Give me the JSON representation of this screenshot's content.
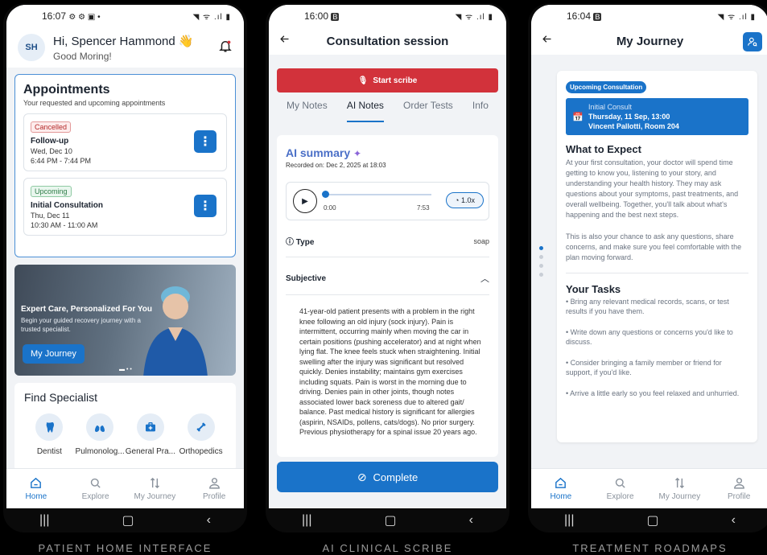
{
  "phone1": {
    "status_time": "16:07",
    "status_icons": "⚙ ⚙ ▣ •",
    "status_right": "◥ ᯤ .ıl ▮",
    "avatar_initials": "SH",
    "greeting": "Hi, Spencer Hammond 👋",
    "subgreeting": "Good Moring!",
    "appointments_title": "Appointments",
    "appointments_subtitle": "Your requested and upcoming appointments",
    "appointments": [
      {
        "status": "Cancelled",
        "title": "Follow-up",
        "date": "Wed, Dec 10",
        "time": "6:44 PM - 7:44 PM"
      },
      {
        "status": "Upcoming",
        "title": "Initial Consultation",
        "date": "Thu, Dec 11",
        "time": "10:30 AM - 11:00 AM"
      }
    ],
    "banner_title": "Expert Care, Personalized For You",
    "banner_text": "Begin your guided recovery journey with a trusted specialist.",
    "banner_button": "My Journey",
    "find_title": "Find Specialist",
    "specialists": [
      {
        "label": "Dentist",
        "icon": "tooth-icon"
      },
      {
        "label": "Pulmonolog...",
        "icon": "lungs-icon"
      },
      {
        "label": "General Pra...",
        "icon": "medical-kit-icon"
      },
      {
        "label": "Orthopedics",
        "icon": "bone-icon"
      }
    ],
    "caption": "PATIENT HOME INTERFACE"
  },
  "phone2": {
    "status_time": "16:00",
    "status_right": "◥ ᯤ .ıl ▮",
    "title": "Consultation session",
    "scribe_button": "Start scribe",
    "tabs": [
      "My Notes",
      "AI Notes",
      "Order Tests",
      "Info"
    ],
    "ai_summary_title": "AI summary",
    "recorded_on": "Recorded on: Dec 2, 2025 at 18:03",
    "time_start": "0:00",
    "time_end": "7:53",
    "speed": "1.0x",
    "type_label": "Type",
    "type_value": "soap",
    "subjective_label": "Subjective",
    "subjective_text": "41-year-old patient presents with a problem in the right knee following an old injury (sock injury). Pain is intermittent, occurring mainly when moving the car in certain positions (pushing accelerator) and at night when lying flat. The knee feels stuck when straightening. Initial swelling after the injury was significant but resolved quickly. Denies instability; maintains gym exercises including squats. Pain is worst in the morning due to driving. Denies pain in other joints, though notes associated lower back soreness due to altered gait/ balance. Past medical history is significant for allergies (aspirin, NSAIDs, pollens, cats/dogs). No prior surgery. Previous physiotherapy for a spinal issue 20 years ago.",
    "complete_button": "Complete",
    "caption": "AI CLINICAL SCRIBE"
  },
  "phone3": {
    "status_time": "16:04",
    "status_right": "◥ ᯤ .ıl ▮",
    "title": "My Journey",
    "upcoming_badge": "Upcoming Consultation",
    "consult_title": "Initial Consult",
    "consult_when": "Thursday, 11 Sep, 13:00",
    "consult_where": "Vincent Pallotti, Room 204",
    "expect_title": "What to Expect",
    "expect_p1": "At your first consultation, your doctor will spend time getting to know you, listening to your story, and understanding your health history. They may ask questions about your symptoms, past treatments, and overall wellbeing. Together, you'll talk about what's happening and the best next steps.",
    "expect_p2": "This is also your chance to ask any questions, share concerns, and make sure you feel comfortable with the plan moving forward.",
    "tasks_title": "Your Tasks",
    "tasks": [
      "• Bring any relevant medical records, scans, or test results if you have them.",
      "• Write down any questions or concerns you'd like to discuss.",
      "• Consider bringing a family member or friend for support, if you'd like.",
      "• Arrive a little early so you feel relaxed and unhurried."
    ],
    "caption": "TREATMENT ROADMAPS"
  },
  "tabbar": [
    "Home",
    "Explore",
    "My Journey",
    "Profile"
  ],
  "colors": {
    "primary": "#1a73c9",
    "danger": "#d2323b",
    "background": "#f1f3f6"
  }
}
